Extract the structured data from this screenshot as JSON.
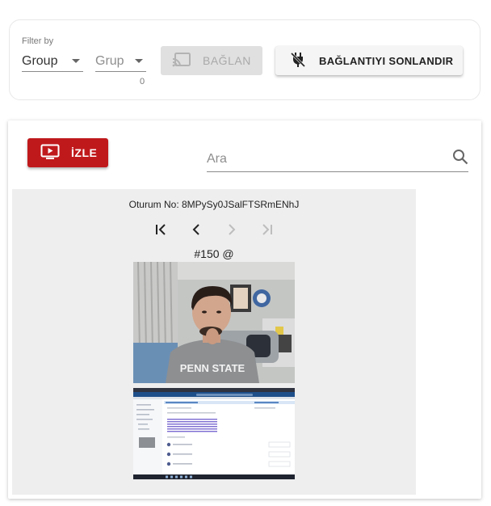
{
  "filter": {
    "filter_by_label": "Filter by",
    "group_value": "Group",
    "grup_placeholder": "Grup",
    "grup_count": "0",
    "connect_label": "BAĞLAN",
    "disconnect_label": "BAĞLANTIYI SONLANDIR"
  },
  "main": {
    "watch_label": "İZLE",
    "search_placeholder": "Ara",
    "session_id": "Oturum No: 8MPySy0JSalFTSRmENhJ",
    "frame_label": "#150 @",
    "webcam_shirt_text": "PENN STATE"
  },
  "icons": {
    "connect": "cast-icon",
    "disconnect": "power-plug-off-icon",
    "watch": "tv-play-icon",
    "search": "search-icon",
    "first": "first-page-icon",
    "prev": "chevron-left-icon",
    "next": "chevron-right-icon",
    "last": "last-page-icon"
  },
  "colors": {
    "watch_button": "#c0191c",
    "disabled_button": "#e0e0e0",
    "panel_background": "#eeeeee"
  }
}
